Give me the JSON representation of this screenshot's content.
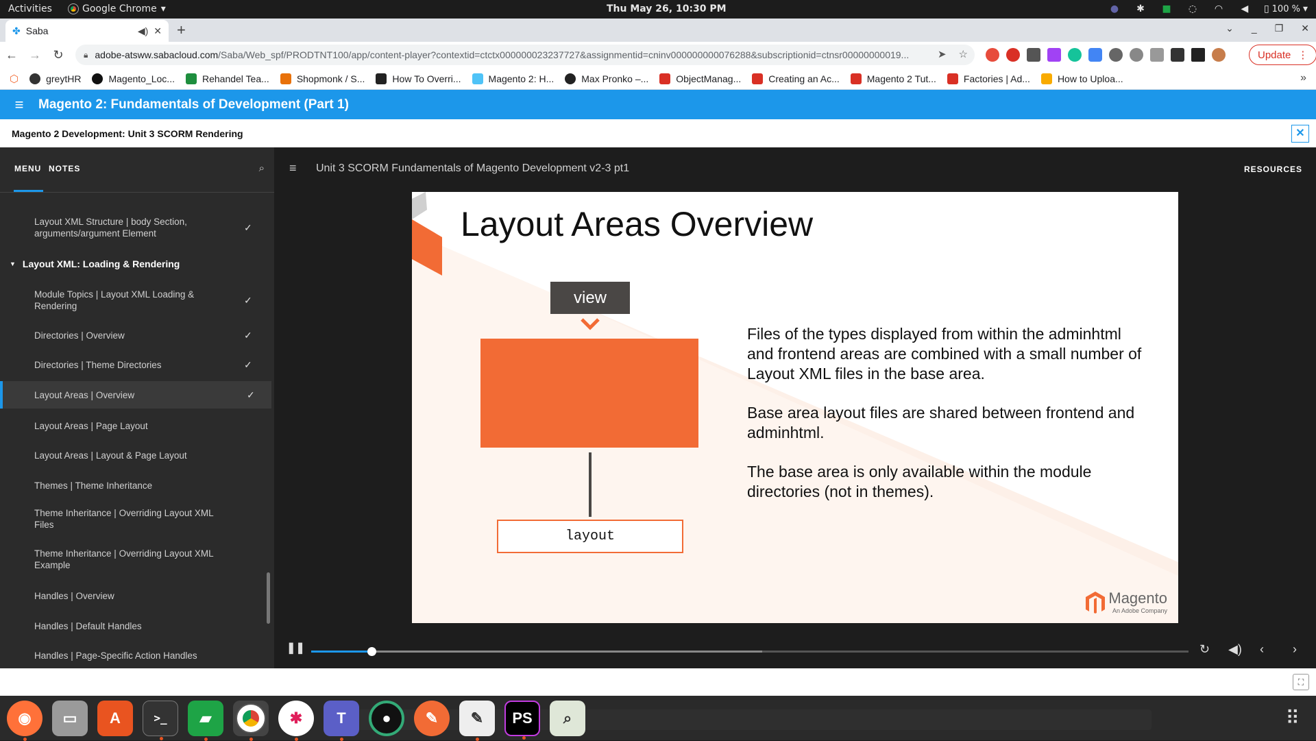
{
  "system_bar": {
    "activities": "Activities",
    "app_name": "Google Chrome",
    "datetime": "Thu May 26, 10:30 PM",
    "battery": "100 %"
  },
  "browser": {
    "tab_title": "Saba",
    "url_host": "adobe-atsww.sabacloud.com",
    "url_path": "/Saba/Web_spf/PRODTNT100/app/content-player?contextid=ctctx000000023237727&assignmentid=cninv000000000076288&subscriptionid=ctnsr00000000019...",
    "update_label": "Update",
    "bookmarks": [
      {
        "label": "greytHR",
        "color": "#333"
      },
      {
        "label": "Magento_Loc...",
        "color": "#111"
      },
      {
        "label": "Rehandel Tea...",
        "color": "#1e8e3e"
      },
      {
        "label": "Shopmonk / S...",
        "color": "#e8710a"
      },
      {
        "label": "How To Overri...",
        "color": "#222"
      },
      {
        "label": "Magento 2: H...",
        "color": "#4fc3f7"
      },
      {
        "label": "Max Pronko –...",
        "color": "#222"
      },
      {
        "label": "ObjectManag...",
        "color": "#d93025"
      },
      {
        "label": "Creating an Ac...",
        "color": "#d93025"
      },
      {
        "label": "Magento 2 Tut...",
        "color": "#d93025"
      },
      {
        "label": "Factories | Ad...",
        "color": "#d93025"
      },
      {
        "label": "How to Uploa...",
        "color": "#f9ab00"
      }
    ]
  },
  "app": {
    "course_title": "Magento 2: Fundamentals of Development (Part 1)",
    "unit_title": "Magento 2 Development: Unit 3 SCORM Rendering"
  },
  "sidebar": {
    "tab_menu": "MENU",
    "tab_notes": "NOTES",
    "items": [
      {
        "label": "Layout XML Structure | body Section, arguments/argument Element",
        "checked": true
      },
      {
        "label": "Module Topics | Layout XML Loading & Rendering",
        "checked": true
      },
      {
        "label": "Directories | Overview",
        "checked": true
      },
      {
        "label": "Directories | Theme Directories",
        "checked": true
      },
      {
        "label": "Layout Areas | Overview",
        "checked": true
      },
      {
        "label": "Layout Areas | Page Layout",
        "checked": false
      },
      {
        "label": "Layout Areas | Layout & Page Layout",
        "checked": false
      },
      {
        "label": "Themes | Theme Inheritance",
        "checked": false
      },
      {
        "label": "Theme Inheritance | Overriding Layout XML Files",
        "checked": false
      },
      {
        "label": "Theme Inheritance | Overriding Layout XML Example",
        "checked": false
      },
      {
        "label": "Handles | Overview",
        "checked": false
      },
      {
        "label": "Handles | Default Handles",
        "checked": false
      },
      {
        "label": "Handles | Page-Specific Action Handles",
        "checked": false
      }
    ],
    "section_label": "Layout XML: Loading & Rendering"
  },
  "player": {
    "title": "Unit 3 SCORM Fundamentals of Magento Development v2-3 pt1",
    "resources": "RESOURCES",
    "progress_fraction": 0.069,
    "buffered_fraction": 0.514
  },
  "slide": {
    "title": "Layout Areas Overview",
    "view_label": "view",
    "layout_label": "layout",
    "paragraphs": [
      "Files of the types displayed from within the adminhtml and frontend areas are combined with a small number of Layout XML files in the base area.",
      "Base area layout files are shared between frontend and adminhtml.",
      "The base area is only available within the module directories (not in themes)."
    ],
    "logo_word": "Magento",
    "logo_sub": "An Adobe Company",
    "accent_color": "#f26b35"
  }
}
